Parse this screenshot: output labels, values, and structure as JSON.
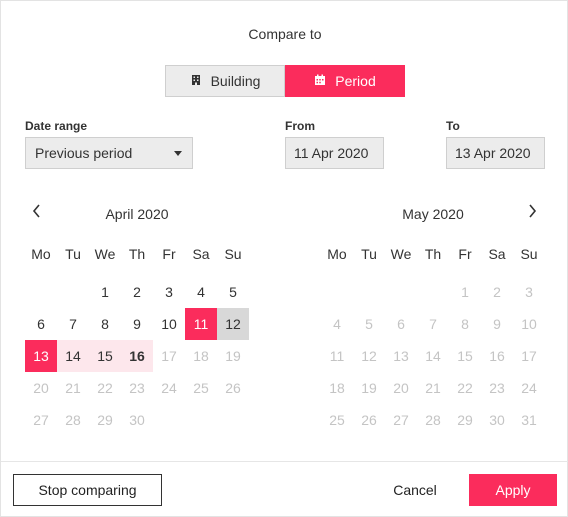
{
  "header": {
    "title": "Compare to"
  },
  "compare_mode": {
    "options": [
      {
        "label": "Building",
        "icon": "building-icon",
        "selected": false
      },
      {
        "label": "Period",
        "icon": "calendar-icon",
        "selected": true
      }
    ]
  },
  "filters": {
    "date_range_label": "Date range",
    "date_range_value": "Previous period",
    "from_label": "From",
    "from_value": "11 Apr 2020",
    "to_label": "To",
    "to_value": "13 Apr 2020"
  },
  "weekday_labels": [
    "Mo",
    "Tu",
    "We",
    "Th",
    "Fr",
    "Sa",
    "Su"
  ],
  "calendars": [
    {
      "month": "April 2020",
      "weeks": [
        [
          null,
          null,
          {
            "d": "1",
            "s": "normal"
          },
          {
            "d": "2",
            "s": "normal"
          },
          {
            "d": "3",
            "s": "normal"
          },
          {
            "d": "4",
            "s": "normal"
          },
          {
            "d": "5",
            "s": "normal"
          }
        ],
        [
          {
            "d": "6",
            "s": "normal"
          },
          {
            "d": "7",
            "s": "normal"
          },
          {
            "d": "8",
            "s": "normal"
          },
          {
            "d": "9",
            "s": "normal"
          },
          {
            "d": "10",
            "s": "normal"
          },
          {
            "d": "11",
            "s": "selected"
          },
          {
            "d": "12",
            "s": "grey"
          }
        ],
        [
          {
            "d": "13",
            "s": "selected"
          },
          {
            "d": "14",
            "s": "range"
          },
          {
            "d": "15",
            "s": "range"
          },
          {
            "d": "16",
            "s": "range-bold"
          },
          {
            "d": "17",
            "s": "muted"
          },
          {
            "d": "18",
            "s": "muted"
          },
          {
            "d": "19",
            "s": "muted"
          }
        ],
        [
          {
            "d": "20",
            "s": "muted"
          },
          {
            "d": "21",
            "s": "muted"
          },
          {
            "d": "22",
            "s": "muted"
          },
          {
            "d": "23",
            "s": "muted"
          },
          {
            "d": "24",
            "s": "muted"
          },
          {
            "d": "25",
            "s": "muted"
          },
          {
            "d": "26",
            "s": "muted"
          }
        ],
        [
          {
            "d": "27",
            "s": "muted"
          },
          {
            "d": "28",
            "s": "muted"
          },
          {
            "d": "29",
            "s": "muted"
          },
          {
            "d": "30",
            "s": "muted"
          },
          null,
          null,
          null
        ]
      ]
    },
    {
      "month": "May 2020",
      "weeks": [
        [
          null,
          null,
          null,
          null,
          {
            "d": "1",
            "s": "muted"
          },
          {
            "d": "2",
            "s": "muted"
          },
          {
            "d": "3",
            "s": "muted"
          }
        ],
        [
          {
            "d": "4",
            "s": "muted"
          },
          {
            "d": "5",
            "s": "muted"
          },
          {
            "d": "6",
            "s": "muted"
          },
          {
            "d": "7",
            "s": "muted"
          },
          {
            "d": "8",
            "s": "muted"
          },
          {
            "d": "9",
            "s": "muted"
          },
          {
            "d": "10",
            "s": "muted"
          }
        ],
        [
          {
            "d": "11",
            "s": "muted"
          },
          {
            "d": "12",
            "s": "muted"
          },
          {
            "d": "13",
            "s": "muted"
          },
          {
            "d": "14",
            "s": "muted"
          },
          {
            "d": "15",
            "s": "muted"
          },
          {
            "d": "16",
            "s": "muted"
          },
          {
            "d": "17",
            "s": "muted"
          }
        ],
        [
          {
            "d": "18",
            "s": "muted"
          },
          {
            "d": "19",
            "s": "muted"
          },
          {
            "d": "20",
            "s": "muted"
          },
          {
            "d": "21",
            "s": "muted"
          },
          {
            "d": "22",
            "s": "muted"
          },
          {
            "d": "23",
            "s": "muted"
          },
          {
            "d": "24",
            "s": "muted"
          }
        ],
        [
          {
            "d": "25",
            "s": "muted"
          },
          {
            "d": "26",
            "s": "muted"
          },
          {
            "d": "27",
            "s": "muted"
          },
          {
            "d": "28",
            "s": "muted"
          },
          {
            "d": "29",
            "s": "muted"
          },
          {
            "d": "30",
            "s": "muted"
          },
          {
            "d": "31",
            "s": "muted"
          }
        ]
      ]
    }
  ],
  "footer": {
    "stop_label": "Stop comparing",
    "cancel_label": "Cancel",
    "apply_label": "Apply"
  },
  "colors": {
    "accent": "#fb2c5c",
    "range_fill": "#fde7ec",
    "field_bg": "#ececec",
    "muted_text": "#c4c4c4"
  }
}
